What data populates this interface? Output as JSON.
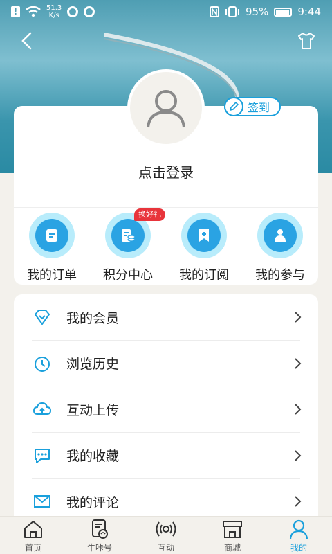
{
  "status_bar": {
    "speed_value": "51.3",
    "speed_unit": "K/s",
    "battery": "95%",
    "time": "9:44"
  },
  "header": {
    "back_icon": "chevron-left-icon",
    "skin_icon": "tshirt-icon"
  },
  "profile": {
    "login_text": "点击登录",
    "checkin_label": "签到",
    "avatar_icon": "user-outline-icon"
  },
  "quick_actions": [
    {
      "label": "我的订单",
      "icon": "order-doc-icon"
    },
    {
      "label": "积分中心",
      "icon": "points-icon",
      "badge": "换好礼"
    },
    {
      "label": "我的订阅",
      "icon": "bookmark-plus-icon"
    },
    {
      "label": "我的参与",
      "icon": "person-icon"
    }
  ],
  "menu": [
    {
      "label": "我的会员",
      "icon": "diamond-icon"
    },
    {
      "label": "浏览历史",
      "icon": "clock-icon"
    },
    {
      "label": "互动上传",
      "icon": "cloud-upload-icon"
    },
    {
      "label": "我的收藏",
      "icon": "chat-bubbles-icon"
    },
    {
      "label": "我的评论",
      "icon": "mail-icon"
    }
  ],
  "tabs": [
    {
      "label": "首页",
      "icon": "home-icon",
      "active": false
    },
    {
      "label": "牛咔号",
      "icon": "media-icon",
      "active": false
    },
    {
      "label": "互动",
      "icon": "broadcast-icon",
      "active": false
    },
    {
      "label": "商城",
      "icon": "store-icon",
      "active": false
    },
    {
      "label": "我的",
      "icon": "profile-icon",
      "active": true
    }
  ],
  "colors": {
    "accent": "#1aa0dc",
    "badge_red": "#e8343b",
    "hero_blue": "#3a95ad"
  }
}
